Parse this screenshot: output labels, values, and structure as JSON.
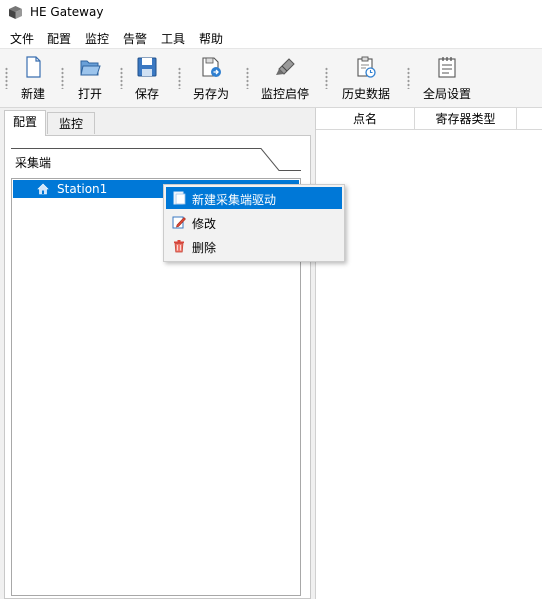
{
  "window": {
    "title": "HE Gateway",
    "icon": "app-cube-icon"
  },
  "menu": [
    "文件",
    "配置",
    "监控",
    "告警",
    "工具",
    "帮助"
  ],
  "toolbar": [
    {
      "label": "新建",
      "icon": "new-file-icon"
    },
    {
      "label": "打开",
      "icon": "open-folder-icon"
    },
    {
      "label": "保存",
      "icon": "save-icon"
    },
    {
      "label": "另存为",
      "icon": "save-as-icon"
    },
    {
      "label": "监控启停",
      "icon": "monitor-icon"
    },
    {
      "label": "历史数据",
      "icon": "history-icon"
    },
    {
      "label": "全局设置",
      "icon": "settings-icon"
    }
  ],
  "tabs": [
    {
      "label": "配置",
      "active": true
    },
    {
      "label": "监控",
      "active": false
    }
  ],
  "group": {
    "label": "采集端"
  },
  "tree": {
    "items": [
      {
        "label": "Station1",
        "icon": "home-icon",
        "selected": true
      }
    ]
  },
  "table": {
    "columns": [
      "点名",
      "寄存器类型"
    ]
  },
  "context_menu": {
    "items": [
      {
        "label": "新建采集端驱动",
        "icon": "new-driver-icon",
        "highlighted": true
      },
      {
        "label": "修改",
        "icon": "edit-icon",
        "highlighted": false
      },
      {
        "label": "删除",
        "icon": "delete-icon",
        "highlighted": false
      }
    ]
  },
  "colors": {
    "accent": "#0078d7",
    "panel_bg": "#f0f0f0",
    "toolbar_bg": "#f5f5f5"
  }
}
